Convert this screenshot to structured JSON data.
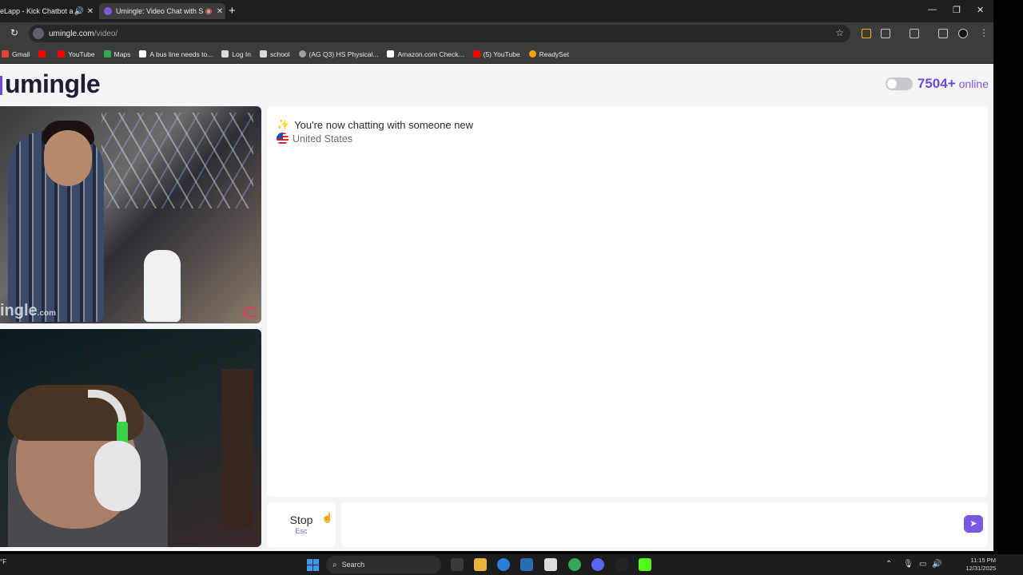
{
  "browser": {
    "tabs": [
      {
        "title": "eLapp - Kick Chatbot a",
        "active": false
      },
      {
        "title": "Umingle: Video Chat with S",
        "active": true
      }
    ],
    "url_host": "umingle.com",
    "url_path": "/video/",
    "bookmarks": [
      {
        "label": "Gmail",
        "color": "#ea4335"
      },
      {
        "label": "",
        "color": "#ff0000"
      },
      {
        "label": "YouTube",
        "color": "#ff0000"
      },
      {
        "label": "Maps",
        "color": "#34a853"
      },
      {
        "label": "A bus line needs to...",
        "color": "#ffffff"
      },
      {
        "label": "Log In",
        "color": "#ffffff"
      },
      {
        "label": "school",
        "color": "#ffffff"
      },
      {
        "label": "(AG Q3) HS Physical...",
        "color": "#9aa0a6"
      },
      {
        "label": "Amazon.com Check...",
        "color": "#ffffff"
      },
      {
        "label": "(5) YouTube",
        "color": "#ff0000"
      },
      {
        "label": "ReadySet",
        "color": "#f4a300"
      }
    ]
  },
  "site": {
    "logo": "umingle",
    "online_count": "7504+",
    "online_label": "online",
    "accent": "#6c4ad8"
  },
  "video": {
    "watermark": "ingle",
    "watermark_suffix": ".com"
  },
  "chat": {
    "status_message": "You're now chatting with someone new",
    "country": "United States",
    "stop_label": "Stop",
    "stop_shortcut": "Esc",
    "input_placeholder": ""
  },
  "taskbar": {
    "temp": "°F",
    "search_label": "Search",
    "time": "11:15 PM",
    "date": "12/31/2025"
  }
}
